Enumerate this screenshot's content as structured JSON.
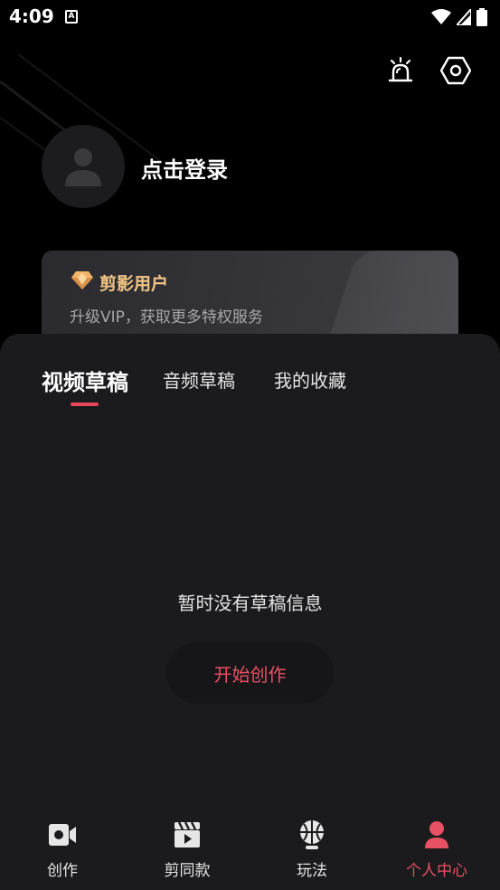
{
  "status_bar": {
    "time": "4:09",
    "notif_letter": "A"
  },
  "header": {
    "alarm_icon": "alarm-light-icon",
    "settings_icon": "hexagon-settings-icon"
  },
  "profile": {
    "login_text": "点击登录"
  },
  "vip": {
    "title": "剪影用户",
    "subtitle": "升级VIP，获取更多特权服务",
    "title_color": "#f3c585"
  },
  "tabs": [
    {
      "label": "视频草稿",
      "active": true
    },
    {
      "label": "音频草稿",
      "active": false
    },
    {
      "label": "我的收藏",
      "active": false
    }
  ],
  "empty_state": {
    "message": "暂时没有草稿信息",
    "button_label": "开始创作"
  },
  "bottom_nav": [
    {
      "label": "创作",
      "icon": "video-camera-icon",
      "active": false
    },
    {
      "label": "剪同款",
      "icon": "clapperboard-icon",
      "active": false
    },
    {
      "label": "玩法",
      "icon": "basketball-icon",
      "active": false
    },
    {
      "label": "个人中心",
      "icon": "person-icon",
      "active": true
    }
  ],
  "colors": {
    "accent": "#e85063",
    "background": "#000000",
    "panel": "#1b1b1d"
  }
}
